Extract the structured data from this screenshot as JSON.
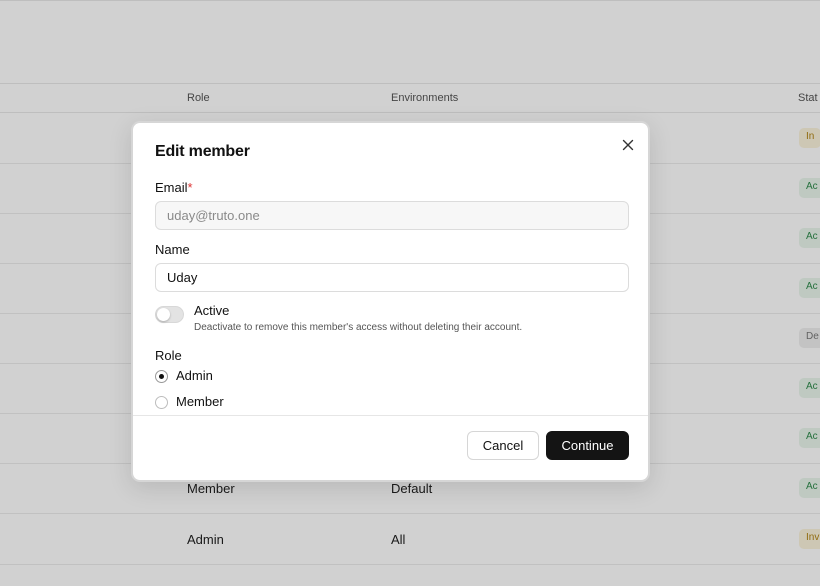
{
  "table": {
    "headers": {
      "role": "Role",
      "environments": "Environments",
      "status": "Stat"
    },
    "rows": [
      {
        "role": "",
        "environments": "",
        "status": "In",
        "status_type": "invited"
      },
      {
        "role": "",
        "environments": "",
        "status": "Ac",
        "status_type": "active"
      },
      {
        "role": "",
        "environments": "",
        "status": "Ac",
        "status_type": "active"
      },
      {
        "role": "",
        "environments": "",
        "status": "Ac",
        "status_type": "active"
      },
      {
        "role": "",
        "environments": "",
        "status": "De",
        "status_type": "deactivated"
      },
      {
        "role": "",
        "environments": "",
        "status": "Ac",
        "status_type": "active"
      },
      {
        "role": "",
        "environments": "",
        "status": "Ac",
        "status_type": "active"
      },
      {
        "role": "Member",
        "environments": "Default",
        "status": "Ac",
        "status_type": "active"
      },
      {
        "role": "Admin",
        "environments": "All",
        "status": "Inv",
        "status_type": "invited"
      }
    ]
  },
  "modal": {
    "title": "Edit member",
    "close_icon": "close-icon",
    "email": {
      "label": "Email",
      "required_mark": "*",
      "placeholder": "uday@truto.one",
      "value": ""
    },
    "name": {
      "label": "Name",
      "value": "Uday"
    },
    "active_toggle": {
      "label": "Active",
      "description": "Deactivate to remove this member's access without deleting their account.",
      "checked": false
    },
    "role": {
      "label": "Role",
      "options": [
        {
          "label": "Admin",
          "checked": true
        },
        {
          "label": "Member",
          "checked": false
        }
      ]
    },
    "cancel_label": "Cancel",
    "continue_label": "Continue"
  },
  "colors": {
    "primary_button": "#141414",
    "active_badge": "#2f8a4b",
    "invited_badge": "#b08312"
  }
}
